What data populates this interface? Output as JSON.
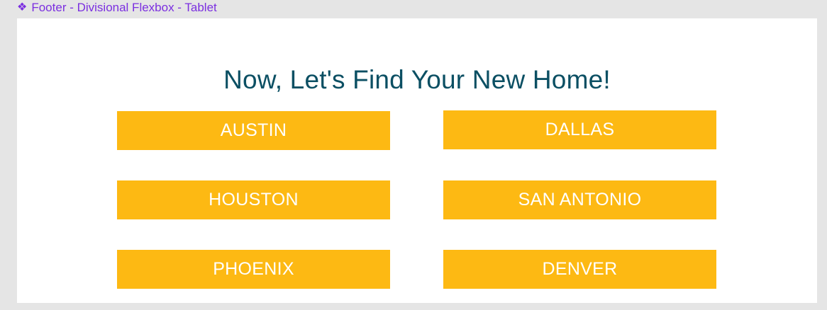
{
  "frame_label": {
    "icon": "component-icon",
    "text": "Footer - Divisional Flexbox - Tablet"
  },
  "headline": "Now, Let's Find Your New Home!",
  "cities": [
    {
      "label": "AUSTIN"
    },
    {
      "label": "DALLAS"
    },
    {
      "label": "HOUSTON"
    },
    {
      "label": "SAN ANTONIO"
    },
    {
      "label": "PHOENIX"
    },
    {
      "label": "DENVER"
    }
  ],
  "colors": {
    "button_bg": "#fdb913",
    "headline": "#0b4f63",
    "frame_label": "#7b2fe0"
  }
}
